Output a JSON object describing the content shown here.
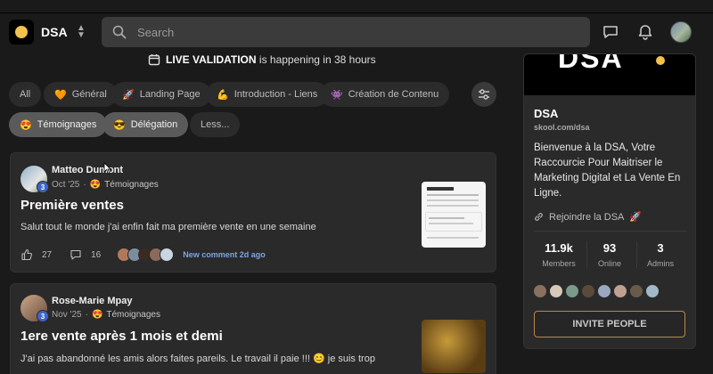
{
  "brand": {
    "name": "DSA"
  },
  "search": {
    "placeholder": "Search"
  },
  "live": {
    "prefix": "LIVE VALIDATION",
    "suffix": "is happening in 38 hours"
  },
  "chips": [
    {
      "label": "All",
      "emoji": "",
      "active": false
    },
    {
      "label": "Général",
      "emoji": "🧡",
      "active": false
    },
    {
      "label": "Landing Page",
      "emoji": "🚀",
      "active": false
    },
    {
      "label": "Introduction - Liens",
      "emoji": "💪",
      "active": false
    },
    {
      "label": "Création de Contenu",
      "emoji": "👾",
      "active": false
    },
    {
      "label": "Témoignages",
      "emoji": "😍",
      "active": true
    },
    {
      "label": "Délégation",
      "emoji": "😎",
      "active": true
    },
    {
      "label": "Less...",
      "emoji": "",
      "active": false
    }
  ],
  "posts": [
    {
      "author": "Matteo Dumont",
      "level": "3",
      "date": "Oct '25",
      "category_emoji": "😍",
      "category": "Témoignages",
      "title": "Première ventes",
      "body": "Salut tout le monde j'ai enfin fait ma première vente en une semaine",
      "likes": "27",
      "comments": "16",
      "new_comment": "New comment 2d ago"
    },
    {
      "author": "Rose-Marie Mpay",
      "level": "3",
      "date": "Nov '25",
      "category_emoji": "😍",
      "category": "Témoignages",
      "title": "1ere vente après 1 mois et demi",
      "body": "J'ai pas abandonné les amis alors faites pareils. Le travail il paie !!! 😊 je suis trop"
    }
  ],
  "sidebar": {
    "cover_text": "DSA",
    "name": "DSA",
    "url": "skool.com/dsa",
    "description": "Bienvenue à la DSA, Votre Raccourcie Pour Maitriser le Marketing Digital et La Vente En Ligne.",
    "join_label": "Rejoindre la DSA",
    "join_emoji": "🚀",
    "stats": [
      {
        "value": "11.9k",
        "label": "Members"
      },
      {
        "value": "93",
        "label": "Online"
      },
      {
        "value": "3",
        "label": "Admins"
      }
    ],
    "invite_label": "INVITE PEOPLE"
  },
  "colors": {
    "accent": "#f2c14e",
    "level_badge": "#3c64c8",
    "new_comment": "#7fa3e6",
    "invite_border": "#b8894a"
  },
  "icons": [
    "search-icon",
    "chat-icon",
    "bell-icon",
    "calendar-icon",
    "filter-icon",
    "like-icon",
    "comment-icon",
    "link-icon",
    "chevron-updown-icon"
  ]
}
